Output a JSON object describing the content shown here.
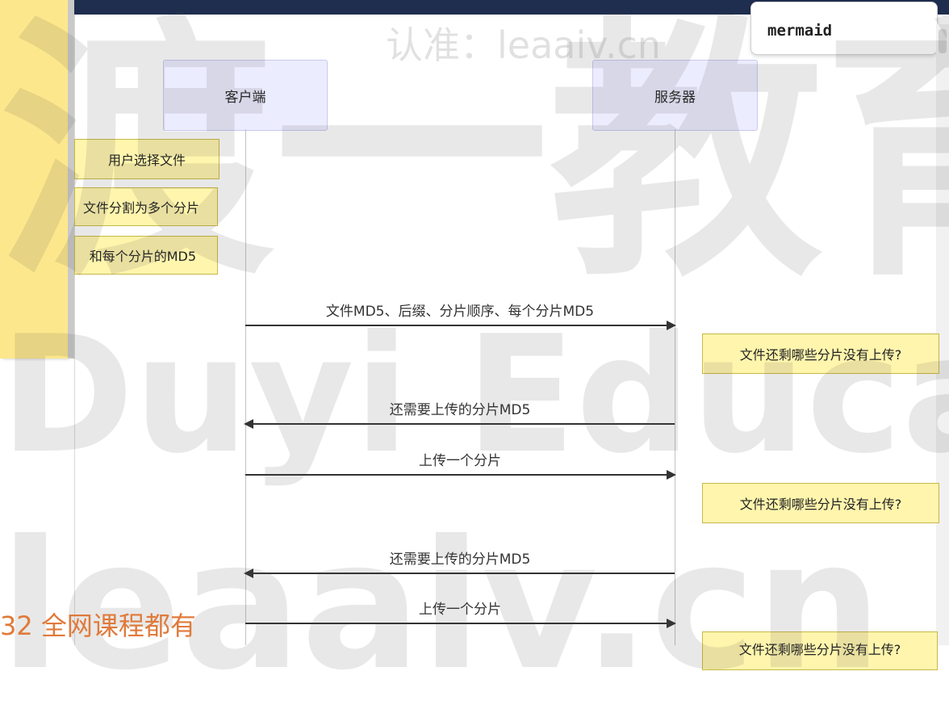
{
  "code_block": {
    "language_tag": "mermaid"
  },
  "diagram": {
    "participants": [
      {
        "id": "client",
        "label": "客户端"
      },
      {
        "id": "server",
        "label": "服务器"
      }
    ],
    "notes": [
      {
        "side": "client",
        "text": "用户选择文件"
      },
      {
        "side": "client",
        "text": "文件分割为多个分片"
      },
      {
        "side": "client",
        "text": "和每个分片的MD5"
      },
      {
        "side": "server",
        "text": "文件还剩哪些分片没有上传?"
      },
      {
        "side": "server",
        "text": "文件还剩哪些分片没有上传?"
      },
      {
        "side": "server",
        "text": "文件还剩哪些分片没有上传?"
      }
    ],
    "messages": [
      {
        "from": "client",
        "to": "server",
        "text": "文件MD5、后缀、分片顺序、每个分片MD5"
      },
      {
        "from": "server",
        "to": "client",
        "text": "还需要上传的分片MD5"
      },
      {
        "from": "client",
        "to": "server",
        "text": "上传一个分片"
      },
      {
        "from": "server",
        "to": "client",
        "text": "还需要上传的分片MD5"
      },
      {
        "from": "client",
        "to": "server",
        "text": "上传一个分片"
      }
    ]
  },
  "watermarks": {
    "top": "认准：leaaiv.cn",
    "big": "渡一教育",
    "duyi": "Duyi Educatio",
    "bottom": "leaaiv.cn"
  },
  "promo": "32 全网课程都有"
}
